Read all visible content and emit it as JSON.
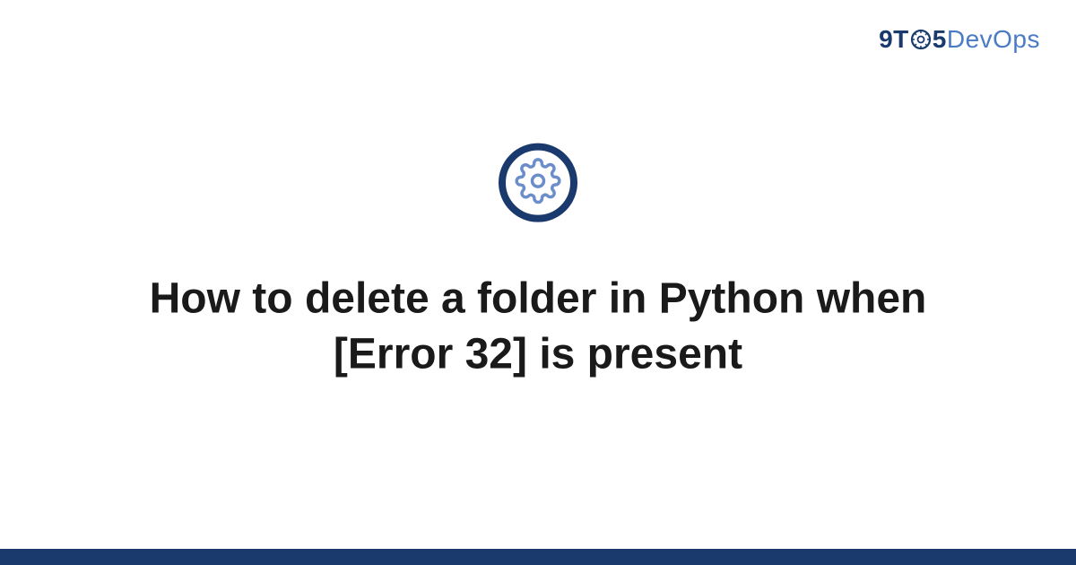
{
  "logo": {
    "part1": "9T",
    "part2": "5",
    "part3": "DevOps"
  },
  "title": "How to delete a folder in Python when [Error 32] is present",
  "colors": {
    "primary": "#1a3a6e",
    "secondary": "#4a7bc4",
    "iconGear": "#6b8dc9"
  }
}
